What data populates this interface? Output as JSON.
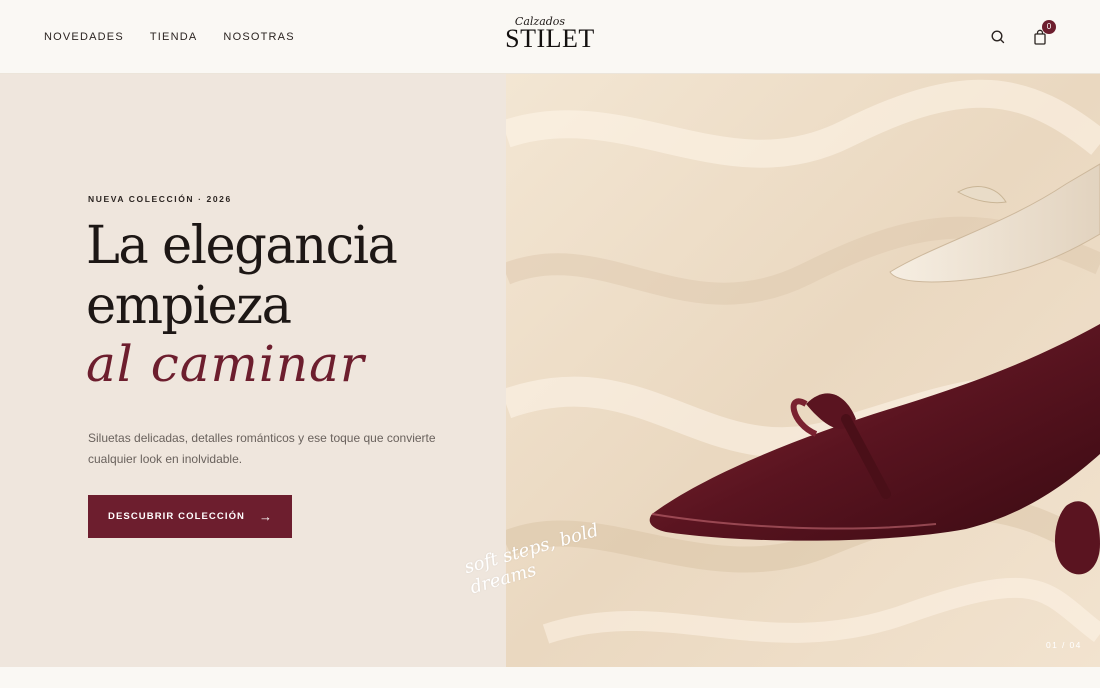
{
  "header": {
    "nav": [
      "NOVEDADES",
      "TIENDA",
      "NOSOTRAS"
    ],
    "logo_script": "Calzados",
    "logo_main": "STILET",
    "search_icon": "search-icon",
    "cart_icon": "shopping-bag-icon",
    "cart_count": "0"
  },
  "hero": {
    "eyebrow": "NUEVA COLECCIÓN · 2026",
    "headline_line1": "La elegancia",
    "headline_line2": "empieza",
    "headline_script": "al caminar",
    "description": "Siluetas delicadas, detalles románticos y ese toque que convierte cualquier look en inolvidable.",
    "cta_label": "DESCUBRIR COLECCIÓN",
    "cta_arrow": "→",
    "tagline": "soft steps, bold dreams",
    "slide_counter": "01 / 04"
  },
  "colors": {
    "accent": "#6d1e2e",
    "hero_bg": "#efe6dd",
    "page_bg": "#faf8f4"
  }
}
